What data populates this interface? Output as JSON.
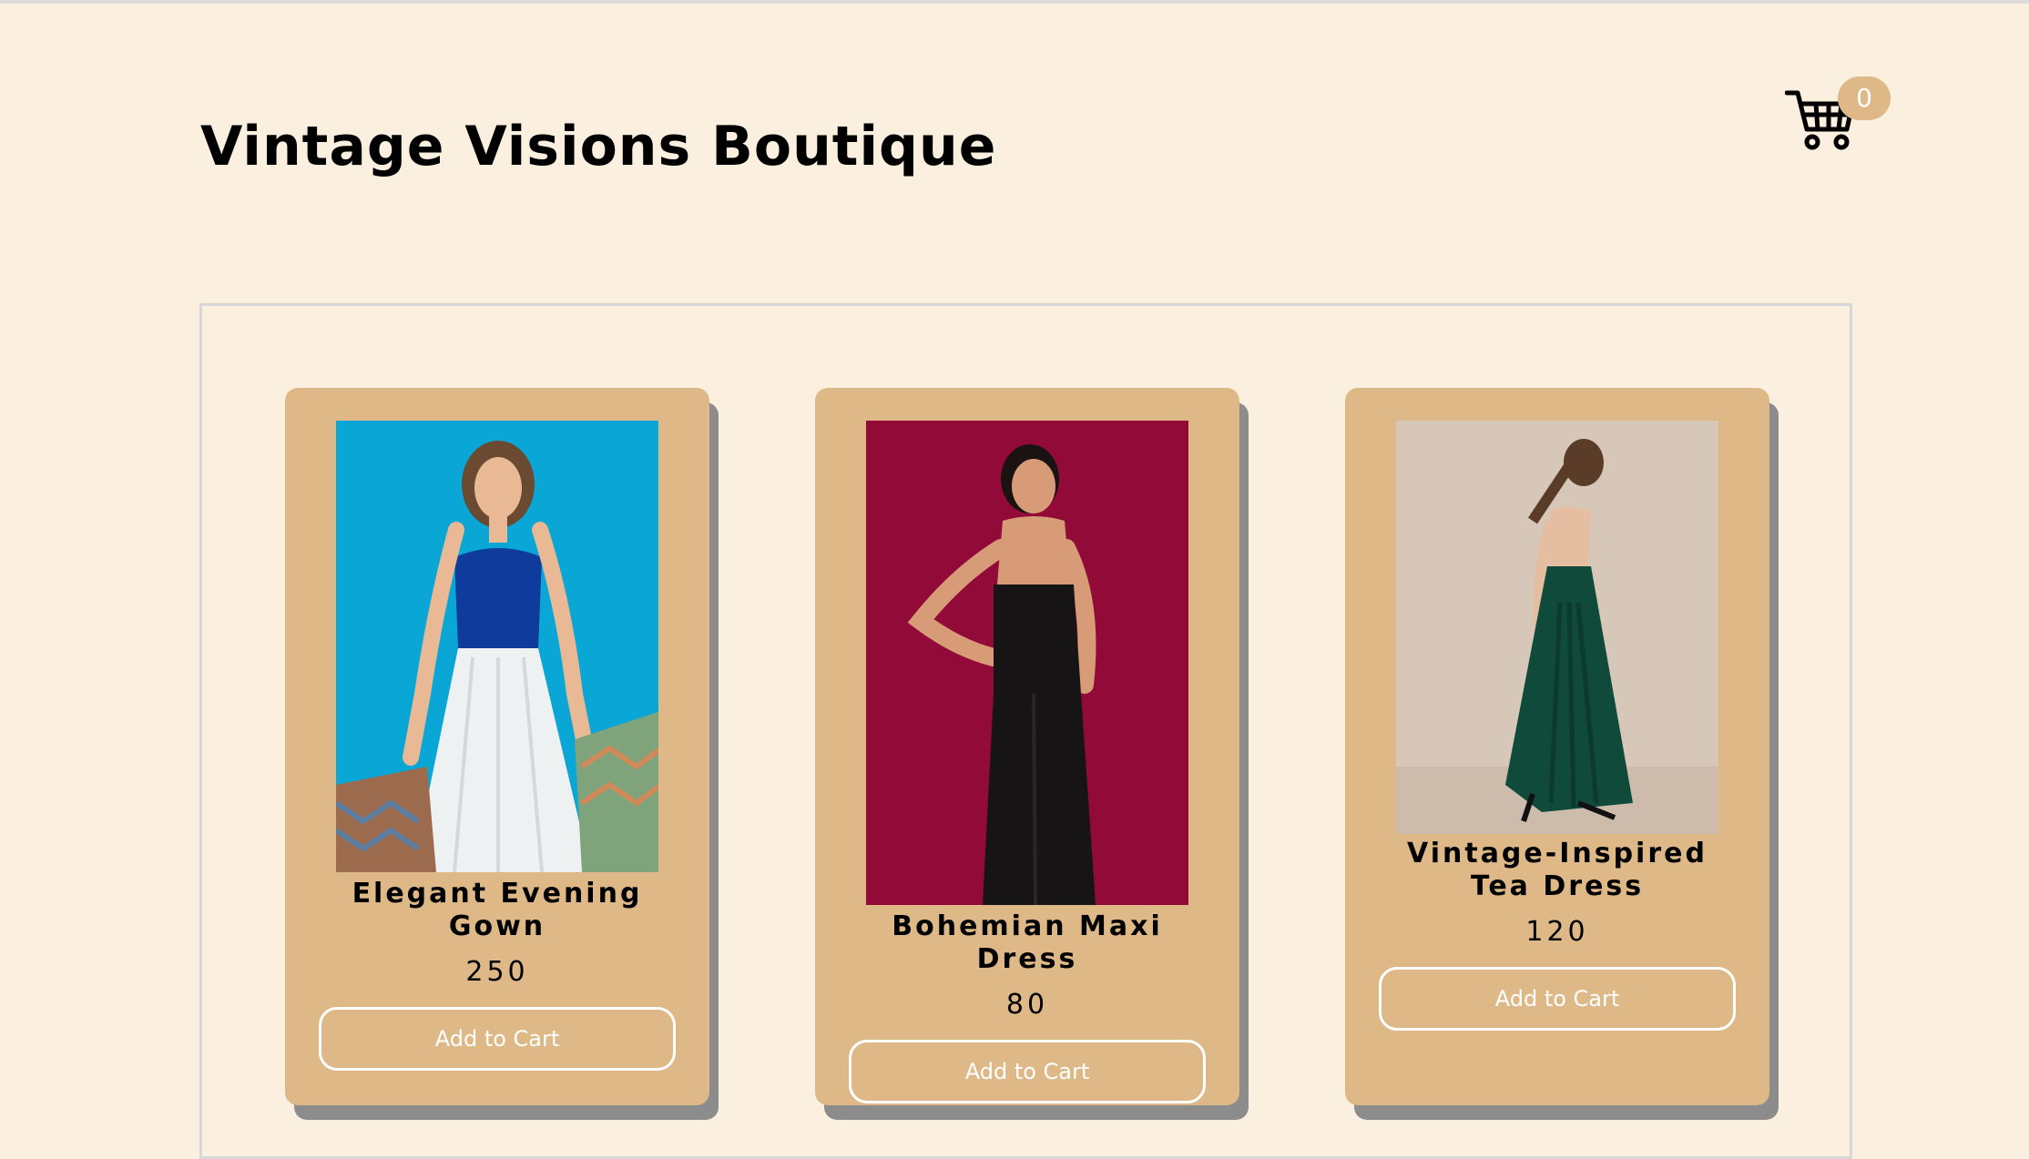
{
  "header": {
    "title": "Vintage Visions Boutique"
  },
  "cart": {
    "icon": "shopping-cart-icon",
    "count": "0"
  },
  "products": [
    {
      "name": "Elegant Evening Gown",
      "price": "250",
      "button_label": "Add to Cart",
      "image": "woman in blue top and white pleated skirt holding shopping bags"
    },
    {
      "name": "Bohemian Maxi Dress",
      "price": "80",
      "button_label": "Add to Cart",
      "image": "woman in black strapless dress on crimson background"
    },
    {
      "name": "Vintage-Inspired Tea Dress",
      "price": "120",
      "button_label": "Add to Cart",
      "image": "woman in green satin dress on beige background"
    }
  ],
  "colors": {
    "page_background": "#fbefdf",
    "card_background": "#deb887",
    "card_shadow": "#8c8c8c",
    "badge": "#deb887",
    "button_text": "#ffffff"
  }
}
